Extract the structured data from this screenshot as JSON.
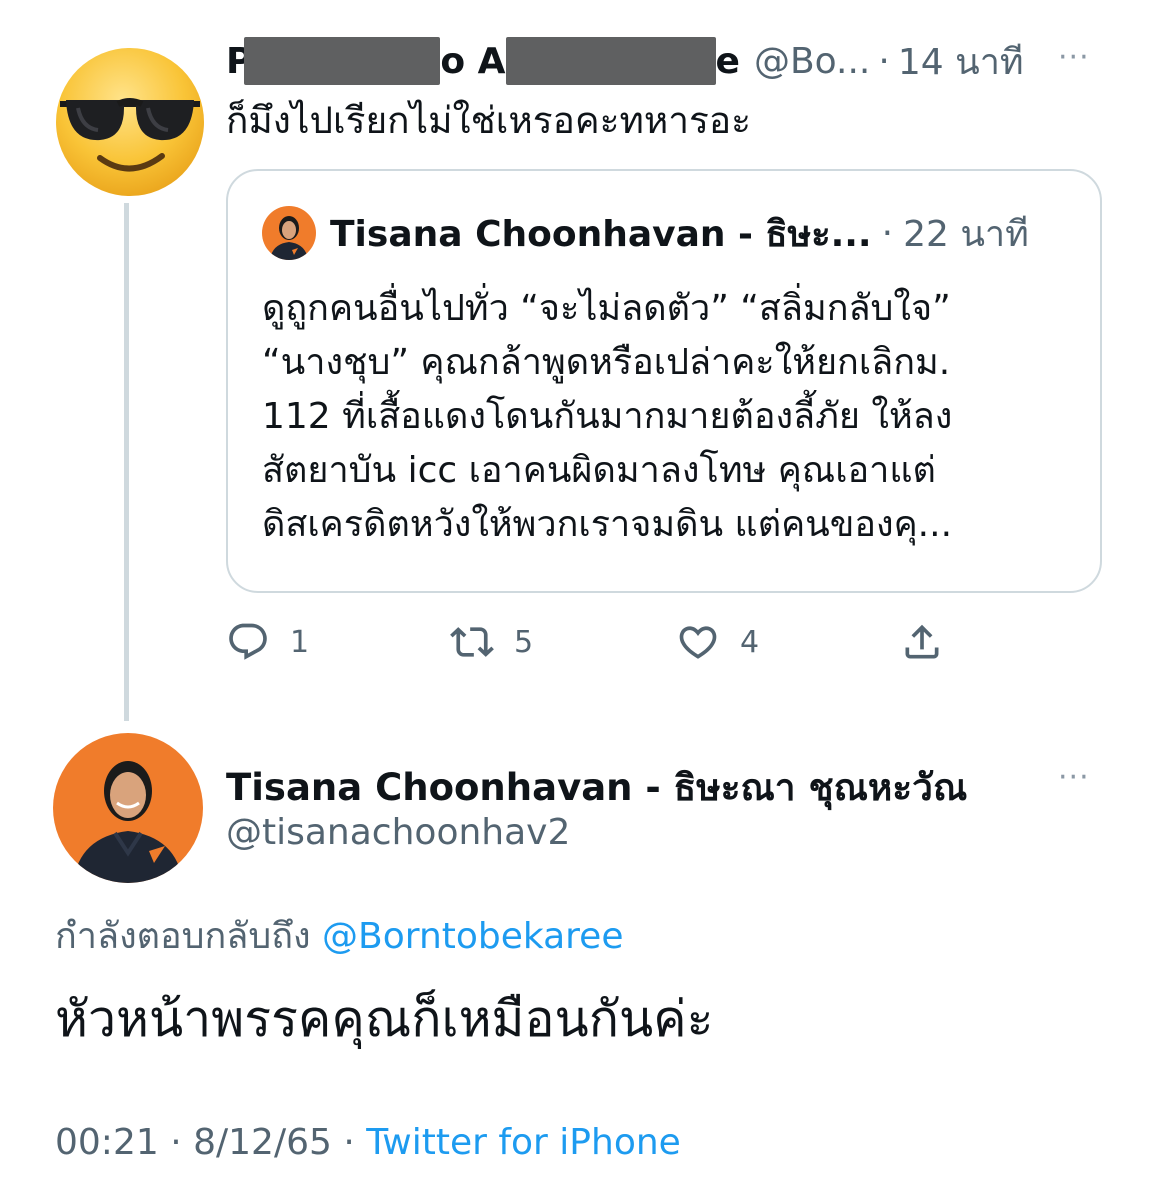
{
  "parent_tweet": {
    "name_fragments": [
      "P",
      "o A",
      "e"
    ],
    "handle": "@Bo...",
    "separator": "·",
    "time": "14 นาที",
    "more_icon": "···",
    "text": "ก็มึงไปเรียกไม่ใช่เหรอคะทหารอะ",
    "quoted_tweet": {
      "name": "Tisana Choonhavan - ธิษะ...",
      "separator": "·",
      "time": "22 นาที",
      "lines": [
        "ดูถูกคนอื่นไปทั่ว “จะไม่ลดตัว” “สลิ่มกลับใจ”",
        "“นางชุบ” คุณกล้าพูดหรือเปล่าคะให้ยกเลิกม.",
        "112 ที่เสื้อแดงโดนกันมากมายต้องลี้ภัย ให้ลง",
        "สัตยาบัน icc เอาคนผิดมาลงโทษ คุณเอาแต่",
        "ดิสเครดิตหวังให้พวกเราจมดิน แต่คนของคุ..."
      ]
    },
    "actions": {
      "reply_count": "1",
      "retweet_count": "5",
      "like_count": "4"
    }
  },
  "main_tweet": {
    "name": "Tisana Choonhavan - ธิษะณา ชุณหะวัณ",
    "handle": "@tisanachoonhav2",
    "more_icon": "···",
    "replying_label": "กำลังตอบกลับถึง",
    "replying_mention": "@Borntobekaree",
    "text": "หัวหน้าพรรคคุณก็เหมือนกันค่ะ",
    "time": "00:21",
    "date": "8/12/65",
    "separator": "·",
    "source": "Twitter for iPhone"
  },
  "colors": {
    "link": "#1d9bf0",
    "secondary_text": "#536471",
    "border": "#cfd9de",
    "avatar_bg": "#f07c2b"
  },
  "icons": [
    "sunglasses-emoji-avatar",
    "reply-icon",
    "retweet-icon",
    "like-icon",
    "share-icon",
    "more-icon"
  ]
}
